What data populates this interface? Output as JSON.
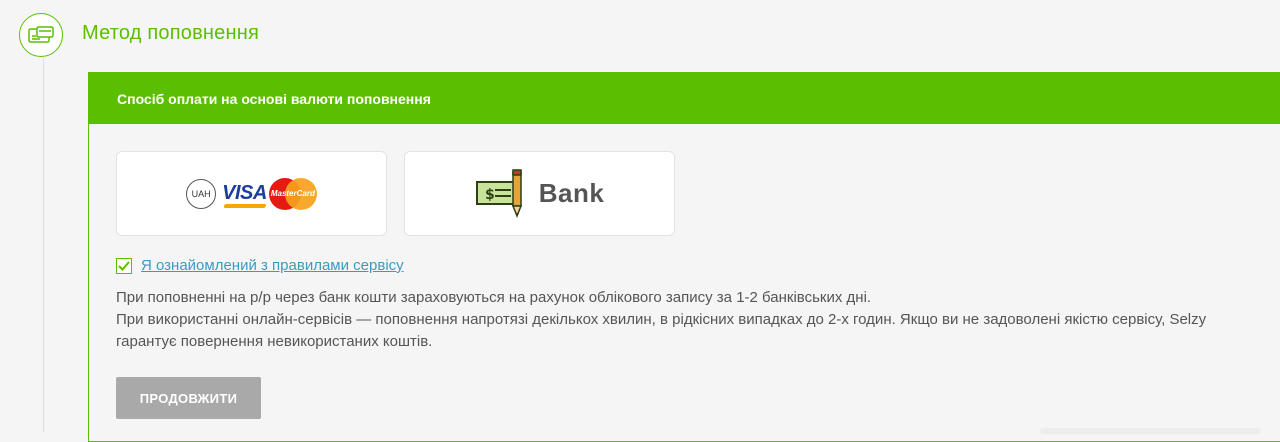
{
  "section": {
    "icon": "payment-card-icon",
    "title": "Метод поповнення"
  },
  "panel": {
    "header": "Спосіб оплати на основі валюти поповнення",
    "methods": [
      {
        "id": "card",
        "currency_badge": "UAH",
        "brands": [
          "VISA",
          "MasterCard"
        ]
      },
      {
        "id": "bank",
        "icon": "check-pencil-icon",
        "label": "Bank"
      }
    ],
    "agreement": {
      "checked": true,
      "label": "Я ознайомлений з правилами сервісу"
    },
    "info": [
      "При поповненні на р/р через банк кошти зараховуються на рахунок облікового запису за 1-2 банківських дні.",
      "При використанні онлайн-сервісів — поповнення напротязі декількох хвилин, в рідкісних випадках до 2-х годин. Якщо ви не задоволені якістю сервісу, Selzy гарантує повернення невикористаних коштів."
    ],
    "continue_label": "ПРОДОВЖИТИ"
  },
  "colors": {
    "accent": "#5bbf00",
    "link": "#3b9bbf",
    "button_disabled": "#a9a9a9"
  }
}
